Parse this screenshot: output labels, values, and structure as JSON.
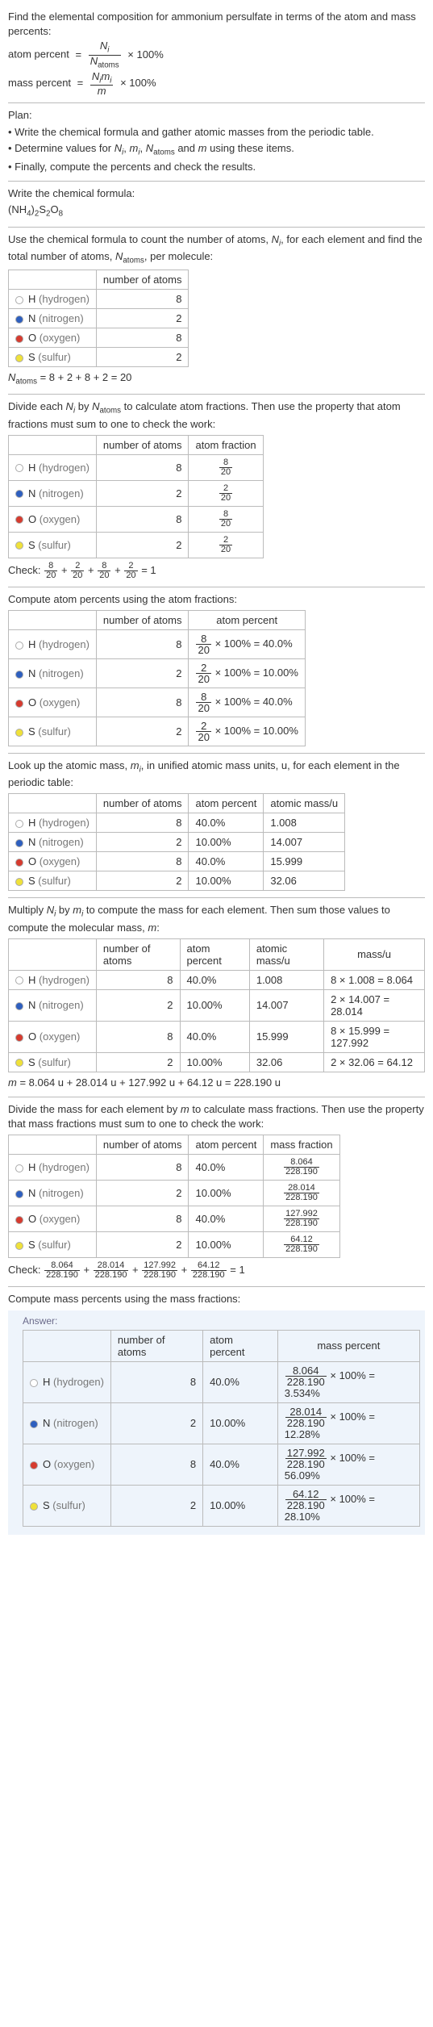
{
  "intro": {
    "line1": "Find the elemental composition for ammonium persulfate in terms of the atom and mass percents:",
    "atom_percent_label": "atom percent",
    "mass_percent_label": "mass percent",
    "eq": "=",
    "x100": "× 100%",
    "frac_atom_top": "N",
    "frac_atom_top_sub": "i",
    "frac_atom_bot": "N",
    "frac_atom_bot_sub": "atoms",
    "frac_mass_top_N": "N",
    "frac_mass_top_sub": "i",
    "frac_mass_top_m": "m",
    "frac_mass_top_msub": "i",
    "frac_mass_bot": "m"
  },
  "plan": {
    "heading": "Plan:",
    "b1_pre": "• Write the chemical formula and gather atomic masses from the periodic table.",
    "b2_pre": "• Determine values for ",
    "b2_post": " using these items.",
    "b3": "• Finally, compute the percents and check the results."
  },
  "sec_formula_label": "Write the chemical formula:",
  "formula": {
    "p1": "(NH",
    "s1": "4",
    "p2": ")",
    "s2": "2",
    "p3": "S",
    "s3": "2",
    "p4": "O",
    "s4": "8"
  },
  "sec_count_pre": "Use the chemical formula to count the number of atoms, ",
  "sec_count_mid": ", for each element and find the total number of atoms, ",
  "sec_count_post": ", per molecule:",
  "headers": {
    "num_atoms": "number of atoms",
    "atom_frac": "atom fraction",
    "atom_pct": "atom percent",
    "atomic_mass": "atomic mass/u",
    "mass_u": "mass/u",
    "mass_frac": "mass fraction",
    "mass_pct": "mass percent"
  },
  "elements": [
    {
      "sym": "H",
      "name": "hydrogen",
      "color": "#ffffff",
      "n": "8",
      "frac_top": "8",
      "frac_bot": "20",
      "pct": "40.0%",
      "pct_frac_top": "8",
      "pct_frac_bot": "20",
      "pct_rhs": "× 100% = 40.0%",
      "amass": "1.008",
      "mass_calc": "8 × 1.008 = 8.064",
      "mfrac_top": "8.064",
      "mfrac_bot": "228.190",
      "mpct_rhs": "× 100% = 3.534%"
    },
    {
      "sym": "N",
      "name": "nitrogen",
      "color": "#2e5fbf",
      "n": "2",
      "frac_top": "2",
      "frac_bot": "20",
      "pct": "10.00%",
      "pct_frac_top": "2",
      "pct_frac_bot": "20",
      "pct_rhs": "× 100% = 10.00%",
      "amass": "14.007",
      "mass_calc": "2 × 14.007 = 28.014",
      "mfrac_top": "28.014",
      "mfrac_bot": "228.190",
      "mpct_rhs": "× 100% = 12.28%"
    },
    {
      "sym": "O",
      "name": "oxygen",
      "color": "#d63b2f",
      "n": "8",
      "frac_top": "8",
      "frac_bot": "20",
      "pct": "40.0%",
      "pct_frac_top": "8",
      "pct_frac_bot": "20",
      "pct_rhs": "× 100% = 40.0%",
      "amass": "15.999",
      "mass_calc": "8 × 15.999 = 127.992",
      "mfrac_top": "127.992",
      "mfrac_bot": "228.190",
      "mpct_rhs": "× 100% = 56.09%"
    },
    {
      "sym": "S",
      "name": "sulfur",
      "color": "#efe13a",
      "n": "2",
      "frac_top": "2",
      "frac_bot": "20",
      "pct": "10.00%",
      "pct_frac_top": "2",
      "pct_frac_bot": "20",
      "pct_rhs": "× 100% = 10.00%",
      "amass": "32.06",
      "mass_calc": "2 × 32.06 = 64.12",
      "mfrac_top": "64.12",
      "mfrac_bot": "228.190",
      "mpct_rhs": "× 100% = 28.10%"
    }
  ],
  "natoms_pre": "N",
  "natoms_sub": "atoms",
  "natoms_rhs": " = 8 + 2 + 8 + 2 = 20",
  "sec_frac_pre": "Divide each ",
  "sec_frac_mid": " by ",
  "sec_frac_post": " to calculate atom fractions. Then use the property that atom fractions must sum to one to check the work:",
  "check_label": "Check: ",
  "check_frac_eq1": " = 1",
  "plus": " + ",
  "sec_atompct": "Compute atom percents using the atom fractions:",
  "sec_amass_pre": "Look up the atomic mass, ",
  "sec_amass_post": ", in unified atomic mass units, u, for each element in the periodic table:",
  "sec_mass_pre": "Multiply ",
  "sec_mass_mid": " by ",
  "sec_mass_post": " to compute the mass for each element. Then sum those values to compute the molecular mass, ",
  "sec_mass_end": ":",
  "m_line_pre": "m",
  "m_line_rhs": " = 8.064 u + 28.014 u + 127.992 u + 64.12 u = 228.190 u",
  "sec_massfrac_pre": "Divide the mass for each element by ",
  "sec_massfrac_post": " to calculate mass fractions. Then use the property that mass fractions must sum to one to check the work:",
  "sec_masspct": "Compute mass percents using the mass fractions:",
  "answer_label": "Answer:",
  "sym_Ni_pre": "N",
  "sym_i": "i",
  "sym_mi_pre": "m",
  "sym_Natoms_pre": "N",
  "sym_atoms": "atoms",
  "sym_m": "m",
  "and": " and ",
  "comma": ", "
}
